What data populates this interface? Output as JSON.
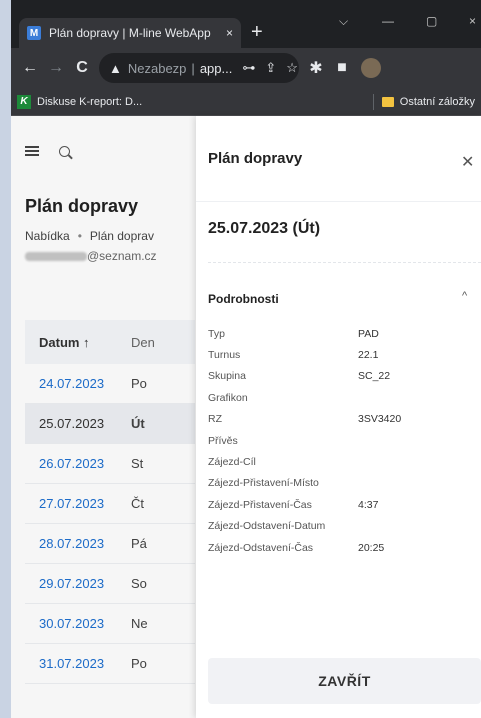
{
  "browser": {
    "tab_title": "Plán dopravy | M-line WebApp",
    "tab_close": "×",
    "new_tab": "+",
    "win_menu": "⌵",
    "win_min": "—",
    "win_max": "▢",
    "win_close": "×",
    "nav_back": "←",
    "nav_forward": "→",
    "nav_reload": "C",
    "omnibox_warning": "Nezabezpečeno",
    "omnibox_warning_shown": "Nezabezp",
    "omnibox_url": "app...",
    "bookmark_1": "Diskuse K-report: D...",
    "bookmark_2": "Ostatní záložky"
  },
  "page": {
    "title": "Plán dopravy",
    "breadcrumb": [
      "Nabídka",
      "Plán doprav"
    ],
    "email_suffix": "@seznam.cz",
    "table": {
      "col_date": "Datum ↑",
      "col_day": "Den",
      "rows": [
        {
          "date": "24.07.2023",
          "day": "Po"
        },
        {
          "date": "25.07.2023",
          "day": "Út"
        },
        {
          "date": "26.07.2023",
          "day": "St"
        },
        {
          "date": "27.07.2023",
          "day": "Čt"
        },
        {
          "date": "28.07.2023",
          "day": "Pá"
        },
        {
          "date": "29.07.2023",
          "day": "So"
        },
        {
          "date": "30.07.2023",
          "day": "Ne"
        },
        {
          "date": "31.07.2023",
          "day": "Po"
        }
      ]
    }
  },
  "drawer": {
    "title": "Plán dopravy",
    "date": "25.07.2023 (Út)",
    "section": "Podrobnosti",
    "details": [
      {
        "label": "Typ",
        "value": "PAD"
      },
      {
        "label": "Turnus",
        "value": "22.1"
      },
      {
        "label": "Skupina",
        "value": "SC_22"
      },
      {
        "label": "Grafikon",
        "value": ""
      },
      {
        "label": "RZ",
        "value": "3SV3420"
      },
      {
        "label": "Přívěs",
        "value": ""
      },
      {
        "label": "Zájezd-Cíl",
        "value": ""
      },
      {
        "label": "Zájezd-Přistavení-Místo",
        "value": ""
      },
      {
        "label": "Zájezd-Přistavení-Čas",
        "value": "4:37"
      },
      {
        "label": "Zájezd-Odstavení-Datum",
        "value": ""
      },
      {
        "label": "Zájezd-Odstavení-Čas",
        "value": "20:25"
      }
    ],
    "close_label": "ZAVŘÍT"
  },
  "colors": {
    "link": "#1e6fd0",
    "chrome_dark": "#35363a",
    "tabstrip": "#1f2124"
  }
}
